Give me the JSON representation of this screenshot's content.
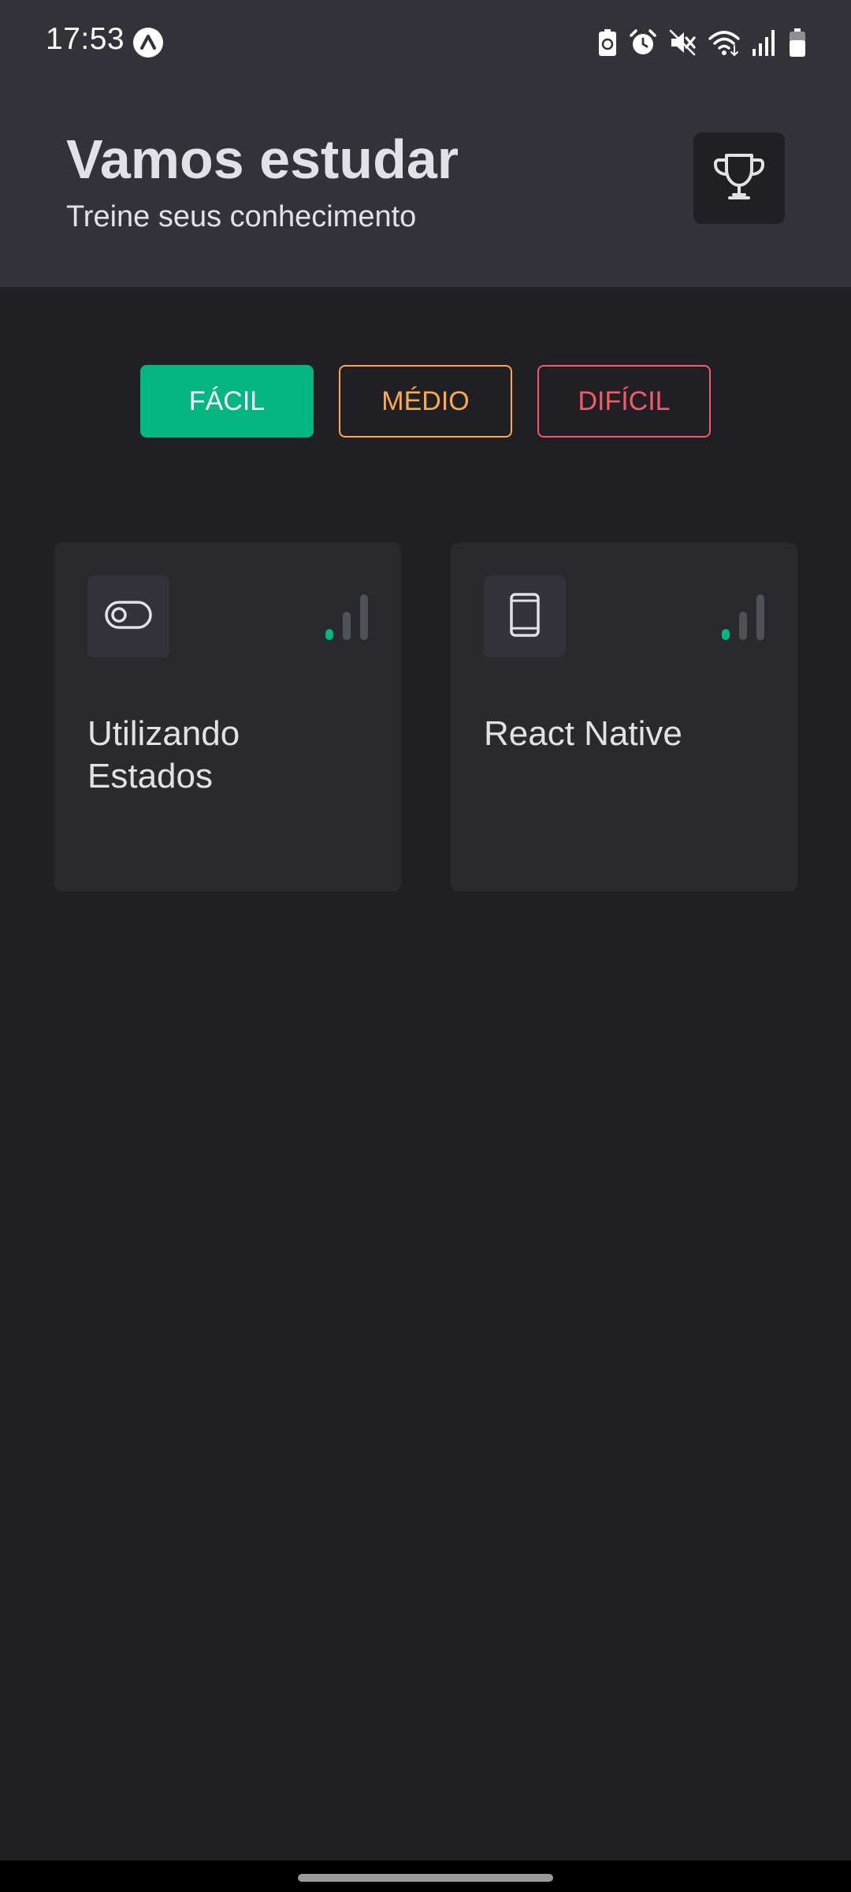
{
  "status_bar": {
    "time": "17:53",
    "icons": [
      "expo-app-icon",
      "battery-saver-icon",
      "alarm-icon",
      "mute-icon",
      "wifi-icon",
      "signal-icon",
      "battery-icon"
    ]
  },
  "header": {
    "title": "Vamos estudar",
    "subtitle": "Treine seus conhecimento",
    "action_icon": "trophy-icon"
  },
  "filters": [
    {
      "label": "FÁCIL",
      "color": "#04b780",
      "selected": true
    },
    {
      "label": "MÉDIO",
      "color": "#fba94c",
      "selected": false
    },
    {
      "label": "DIFÍCIL",
      "color": "#f75a68",
      "selected": false
    }
  ],
  "quizzes": [
    {
      "title": "Utilizando Estados",
      "icon": "toggle-icon",
      "level": 1
    },
    {
      "title": "React Native",
      "icon": "smartphone-icon",
      "level": 1
    }
  ],
  "colors": {
    "background": "#202024",
    "header": "#323238",
    "card": "#29292e",
    "text": "#e1e1e6",
    "level_active": "#04b780",
    "level_inactive": "#505059"
  }
}
